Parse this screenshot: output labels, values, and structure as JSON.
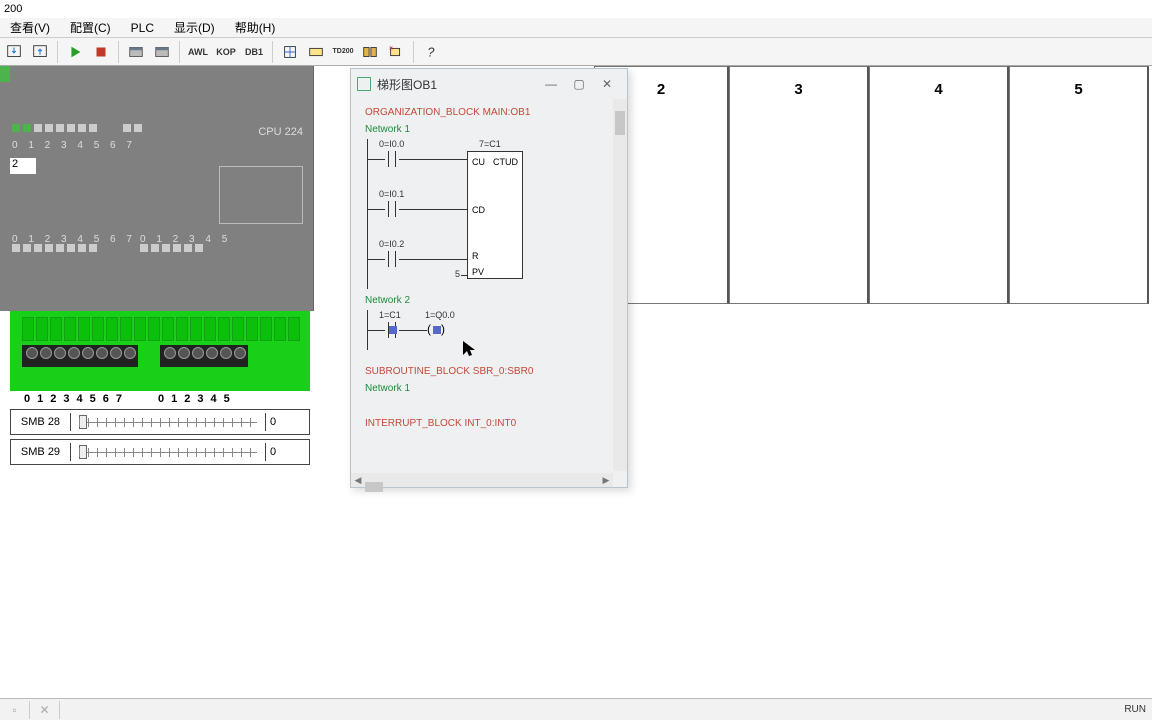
{
  "title": "200",
  "menu": {
    "view": "查看(V)",
    "config": "配置(C)",
    "plc": "PLC",
    "display": "显示(D)",
    "help": "帮助(H)"
  },
  "toolbar": {
    "t_awl": "AWL",
    "t_kop": "KOP",
    "t_db1": "DB1",
    "t_td": "TD200"
  },
  "sim": {
    "cpu": "CPU 224",
    "nums_a": "0 1 2 3 4 5 6 7",
    "nums_b": "0 1",
    "disp": "2",
    "nums_c": "0 1 2 3 4 5 6 7",
    "nums_d": "0 1 2 3 4 5",
    "term_a": [
      "0",
      "1",
      "2",
      "3",
      "4",
      "5",
      "6",
      "7"
    ],
    "term_b": [
      "0",
      "1",
      "2",
      "3",
      "4",
      "5"
    ]
  },
  "smb": [
    {
      "label": "SMB 28",
      "value": "0"
    },
    {
      "label": "SMB 29",
      "value": "0"
    }
  ],
  "panes": [
    "2",
    "3",
    "4",
    "5"
  ],
  "dialog": {
    "title": "梯形图OB1",
    "ob": "ORGANIZATION_BLOCK MAIN:OB1",
    "net1": "Network 1",
    "r1": {
      "i0": "0=I0.0",
      "i1": "0=I0.1",
      "i2": "0=I0.2",
      "c1": "7=C1",
      "cu": "CU",
      "ctud": "CTUD",
      "cd": "CD",
      "r": "R",
      "pv": "PV",
      "pvv": "5"
    },
    "net2": "Network 2",
    "r2": {
      "c1": "1=C1",
      "q0": "1=Q0.0"
    },
    "sbr": "SUBROUTINE_BLOCK SBR_0:SBR0",
    "net1b": "Network 1",
    "int": "INTERRUPT_BLOCK INT_0:INT0"
  },
  "status": {
    "run": "RUN"
  }
}
